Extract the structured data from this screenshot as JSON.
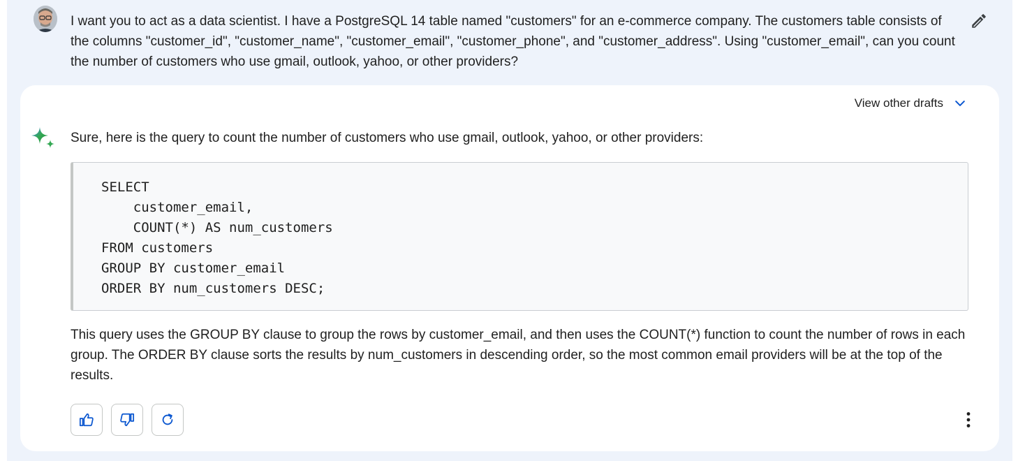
{
  "prompt": {
    "text": "I want you to act as a data scientist. I have a PostgreSQL 14 table named \"customers\" for an e-commerce company. The customers table consists of the columns \"customer_id\", \"customer_name\", \"customer_email\", \"customer_phone\", and \"customer_address\". Using \"customer_email\", can you count the number of customers who use gmail, outlook, yahoo, or other providers?",
    "avatar_icon": "user-avatar",
    "edit_icon": "pencil-icon"
  },
  "response": {
    "drafts_label": "View other drafts",
    "drafts_icon": "chevron-down-icon",
    "assistant_icon": "sparkle-icon",
    "intro": "Sure, here is the query to count the number of customers who use gmail, outlook, yahoo, or other providers:",
    "code": "SELECT\n    customer_email,\n    COUNT(*) AS num_customers\nFROM customers\nGROUP BY customer_email\nORDER BY num_customers DESC;",
    "explanation": "This query uses the GROUP BY clause to group the rows by customer_email, and then uses the COUNT(*) function to count the number of rows in each group. The ORDER BY clause sorts the results by num_customers in descending order, so the most common email providers will be at the top of the results.",
    "actions": [
      {
        "name": "thumbs-up-icon"
      },
      {
        "name": "thumbs-down-icon"
      },
      {
        "name": "regenerate-icon"
      }
    ],
    "more_icon": "more-vert-icon"
  },
  "colors": {
    "page_background": "#eef3fb",
    "card_background": "#ffffff",
    "accent_blue": "#0b57d0",
    "code_background": "#f8f9fa"
  }
}
